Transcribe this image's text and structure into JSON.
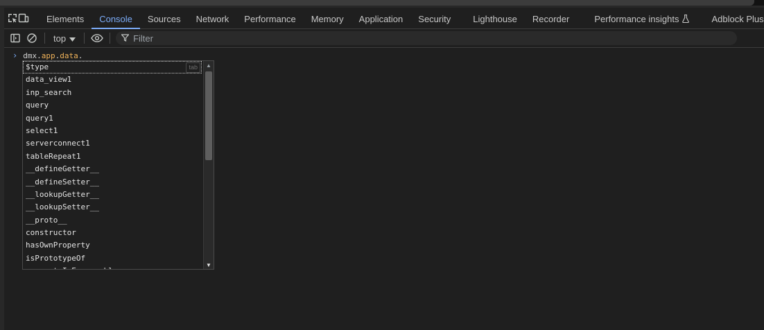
{
  "tabs": [
    {
      "label": "Elements",
      "active": false
    },
    {
      "label": "Console",
      "active": true
    },
    {
      "label": "Sources",
      "active": false
    },
    {
      "label": "Network",
      "active": false
    },
    {
      "label": "Performance",
      "active": false
    },
    {
      "label": "Memory",
      "active": false
    },
    {
      "label": "Application",
      "active": false
    },
    {
      "label": "Security",
      "active": false
    },
    {
      "label": "Lighthouse",
      "active": false
    },
    {
      "label": "Recorder",
      "active": false
    },
    {
      "label": "Performance insights",
      "active": false
    },
    {
      "label": "Adblock Plus",
      "active": false
    }
  ],
  "toolbar": {
    "context": "top",
    "filter_placeholder": "Filter"
  },
  "console": {
    "input_object": "dmx",
    "input_prop1": "app",
    "input_prop2": "data"
  },
  "autocomplete": {
    "hint": "tab",
    "items": [
      "$type",
      "data_view1",
      "inp_search",
      "query",
      "query1",
      "select1",
      "serverconnect1",
      "tableRepeat1",
      "__defineGetter__",
      "__defineSetter__",
      "__lookupGetter__",
      "__lookupSetter__",
      "__proto__",
      "constructor",
      "hasOwnProperty",
      "isPrototypeOf",
      "propertyIsEnumerable"
    ]
  },
  "colors": {
    "accent": "#7cacf8",
    "property": "#f2b45a",
    "background": "#1f1f1f"
  }
}
